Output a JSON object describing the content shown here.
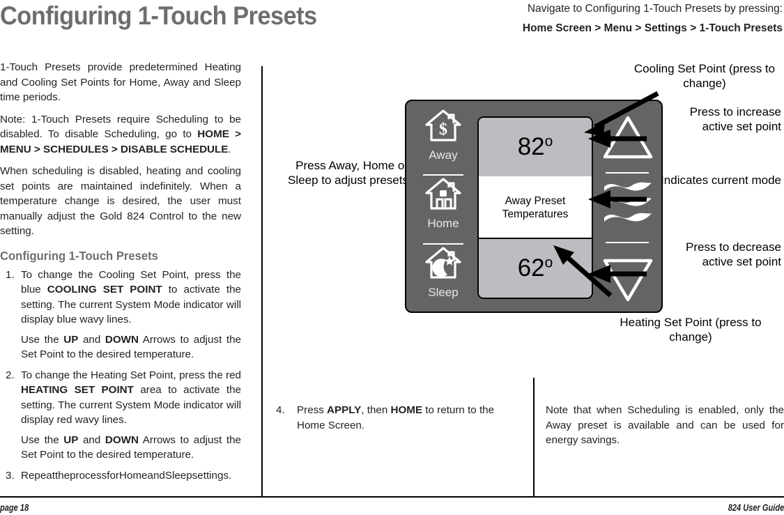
{
  "header": {
    "title": "Configuring 1-Touch Presets",
    "nav_hint": "Navigate to Configuring 1-Touch Presets by pressing:",
    "nav_path": "Home Screen > Menu > Settings > 1-Touch Presets"
  },
  "left_column": {
    "paragraph_1": "1-Touch Presets provide predetermined Heating and Cooling Set Points for Home, Away and Sleep time periods.",
    "note_prefix": "Note: 1-Touch Presets require Scheduling to be disabled. To disable Scheduling, go to ",
    "note_bold": "HOME > MENU > SCHEDULES > DISABLE SCHEDULE",
    "note_suffix": ".",
    "paragraph_3": "When scheduling is disabled, heating and cooling set points are maintained indefinitely. When a temperature change is desired, the user must manually adjust the Gold 824 Control to the new setting.",
    "section_heading": "Configuring 1-Touch Presets",
    "steps": [
      {
        "num": "1.",
        "part_a": "To change the Cooling Set Point, press the blue ",
        "bold_a": "COOLING SET POINT",
        "part_b": " to activate the setting. The current System Mode indicator will display blue wavy lines.",
        "sub_a": "Use the ",
        "sub_bold_1": "UP",
        "sub_b": " and ",
        "sub_bold_2": "DOWN",
        "sub_c": " Arrows to adjust the Set Point to the desired temperature."
      },
      {
        "num": "2.",
        "part_a": "To change the Heating Set Point, press the red ",
        "bold_a": "HEATING SET POINT",
        "part_b": " area to activate the setting. The current System Mode indicator will display red wavy lines.",
        "sub_a": "Use the ",
        "sub_bold_1": "UP",
        "sub_b": " and ",
        "sub_bold_2": "DOWN",
        "sub_c": " Arrows to adjust the Set Point to the desired temperature."
      },
      {
        "num": "3.",
        "text": "RepeattheprocessforHomeandSleepsettings."
      }
    ]
  },
  "figure": {
    "callouts": {
      "press_preset": "Press Away, Home or Sleep to adjust presets",
      "cooling_set_point": "Cooling Set Point (press to change)",
      "increase": "Press to increase active set point",
      "current_mode": "Indicates current mode",
      "decrease": "Press to decrease active set point",
      "heating_set_point": "Heating Set Point (press to change)"
    },
    "thermostat": {
      "presets": [
        {
          "label": "Away",
          "icon": "house-dollar-icon"
        },
        {
          "label": "Home",
          "icon": "house-icon"
        },
        {
          "label": "Sleep",
          "icon": "house-moon-star-icon"
        }
      ],
      "cooling_temp": "82",
      "cooling_degree": "o",
      "heating_temp": "62",
      "heating_degree": "o",
      "display_label_line1": "Away Preset",
      "display_label_line2": "Temperatures",
      "up_arrow_icon": "triangle-up-icon",
      "down_arrow_icon": "triangle-down-icon",
      "mode_icon": "wavy-lines-icon"
    },
    "colors": {
      "body": "#636466",
      "setpoint_panel": "#bcbdc0",
      "display_middle": "#ffffff",
      "title_gray": "#6d6e71",
      "text": "#231f20"
    }
  },
  "bottom": {
    "step4": {
      "num": "4.",
      "part_a": "Press ",
      "bold_a": "APPLY",
      "part_b": ", then ",
      "bold_b": "HOME",
      "part_c": " to return to the Home Screen."
    },
    "note": "Note that when Scheduling is enabled, only the Away preset is available and can be used for energy savings."
  },
  "footer": {
    "left": "page 18",
    "right": "824 User Guide"
  }
}
